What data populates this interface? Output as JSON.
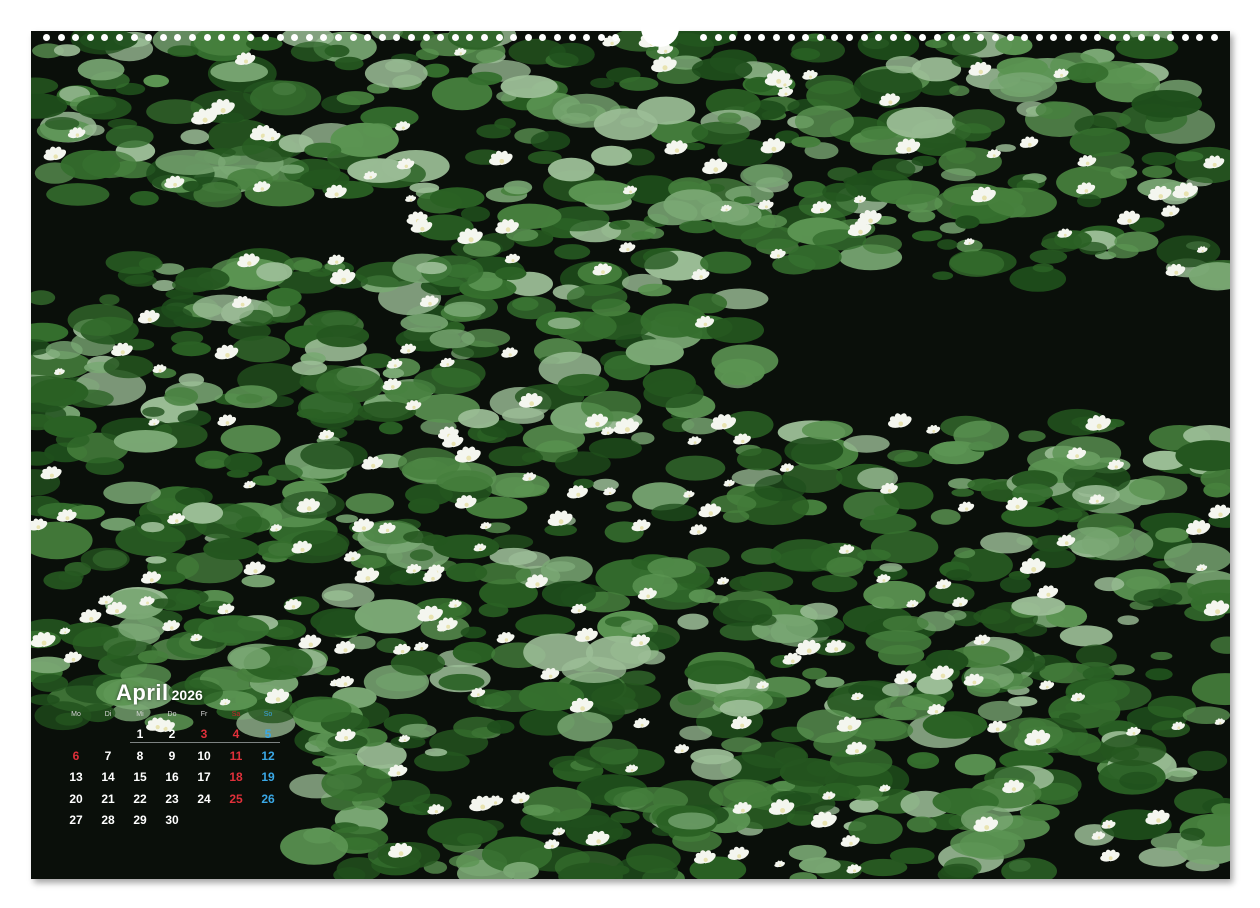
{
  "calendar": {
    "month": "April",
    "year": "2026",
    "weekdays": [
      "Mo",
      "Di",
      "Mi",
      "Do",
      "Fr",
      "Sa",
      "So"
    ],
    "weeks": [
      [
        "",
        "1",
        "2",
        "3",
        "4",
        "5"
      ],
      [
        "6",
        "7",
        "8",
        "9",
        "10",
        "11",
        "12"
      ],
      [
        "13",
        "14",
        "15",
        "16",
        "17",
        "18",
        "19"
      ],
      [
        "20",
        "21",
        "22",
        "23",
        "24",
        "25",
        "26"
      ],
      [
        "27",
        "28",
        "29",
        "30",
        "",
        "",
        ""
      ]
    ],
    "holiday_days": [
      "3",
      "6"
    ],
    "colors": {
      "saturday": "#e0303a",
      "sunday": "#3aa8e6",
      "holiday": "#e0303a",
      "weekday": "#ffffff"
    }
  },
  "photo": {
    "subject": "water lilies on a dark pond",
    "colors": {
      "water": "#0a0f0a",
      "leaf": "#2f6b2a",
      "leaf_light": "#7fb07a",
      "flower": "#f4f6ef"
    }
  }
}
